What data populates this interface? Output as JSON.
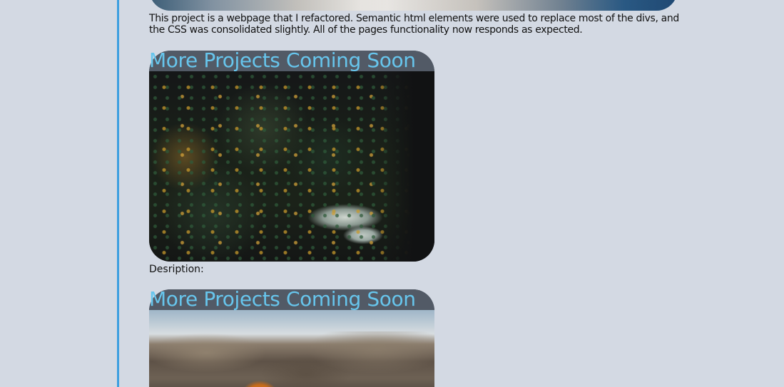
{
  "projects": {
    "top_description": "This project is a webpage that I refactored. Semantic html elements were used to replace most of the divs, and the CSS was consolidated slightly. All of the pages functionality now responds as expected.",
    "cards": [
      {
        "title": "More Projects Coming Soon",
        "caption": "Desription:",
        "image": "forest-lake-photo"
      },
      {
        "title": "More Projects Coming Soon",
        "image": "rocky-hills-autumn-tree-photo"
      }
    ]
  },
  "colors": {
    "background": "#d3d9e3",
    "accent_rule": "#3ea0e0",
    "title_text": "#67c5ec",
    "card_header": "#525a66"
  }
}
